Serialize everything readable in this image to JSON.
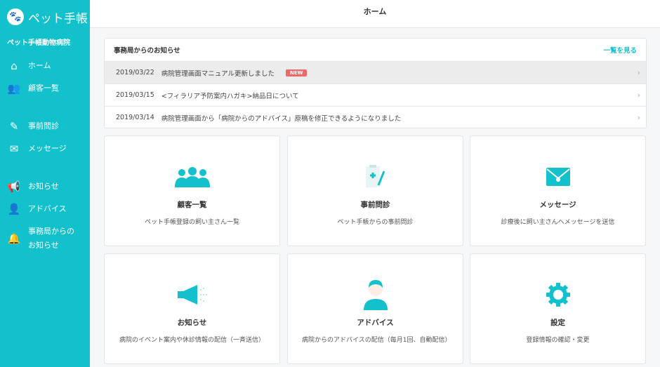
{
  "sidebar": {
    "logo": "ペット手帳",
    "hospital": "ペット手帳動物病院",
    "items": [
      {
        "label": "ホーム",
        "icon": "home-icon"
      },
      {
        "label": "顧客一覧",
        "icon": "users-icon"
      },
      {
        "label": "事前問診",
        "icon": "edit-icon"
      },
      {
        "label": "メッセージ",
        "icon": "envelope-icon"
      },
      {
        "label": "お知らせ",
        "icon": "megaphone-icon"
      },
      {
        "label": "アドバイス",
        "icon": "doctor-icon"
      },
      {
        "label": "事務局からのお知らせ",
        "icon": "bell-icon"
      }
    ]
  },
  "header": {
    "title": "ホーム"
  },
  "notice": {
    "title": "事務局からのお知らせ",
    "view_all": "一覧を見る",
    "badge": "NEW",
    "rows": [
      {
        "date": "2019/03/22",
        "text": "病院管理画面マニュアル更新しました"
      },
      {
        "date": "2019/03/15",
        "text": "<フィラリア予防案内ハガキ>納品日について"
      },
      {
        "date": "2019/03/14",
        "text": "病院管理画面から「病院からのアドバイス」原稿を修正できるようになりました"
      }
    ]
  },
  "cards": [
    {
      "title": "顧客一覧",
      "desc": "ペット手帳登録の飼い主さん一覧"
    },
    {
      "title": "事前問診",
      "desc": "ペット手帳からの事前問診"
    },
    {
      "title": "メッセージ",
      "desc": "診療後に飼い主さんへメッセージを送信"
    },
    {
      "title": "お知らせ",
      "desc": "病院のイベント案内や休診情報の配信（一斉送信）"
    },
    {
      "title": "アドバイス",
      "desc": "病院からのアドバイスの配信（毎月1回、自動配信）"
    },
    {
      "title": "設定",
      "desc": "登録情報の確認・変更"
    }
  ],
  "colors": {
    "accent": "#13c1cc",
    "badge": "#ee6a6a"
  }
}
